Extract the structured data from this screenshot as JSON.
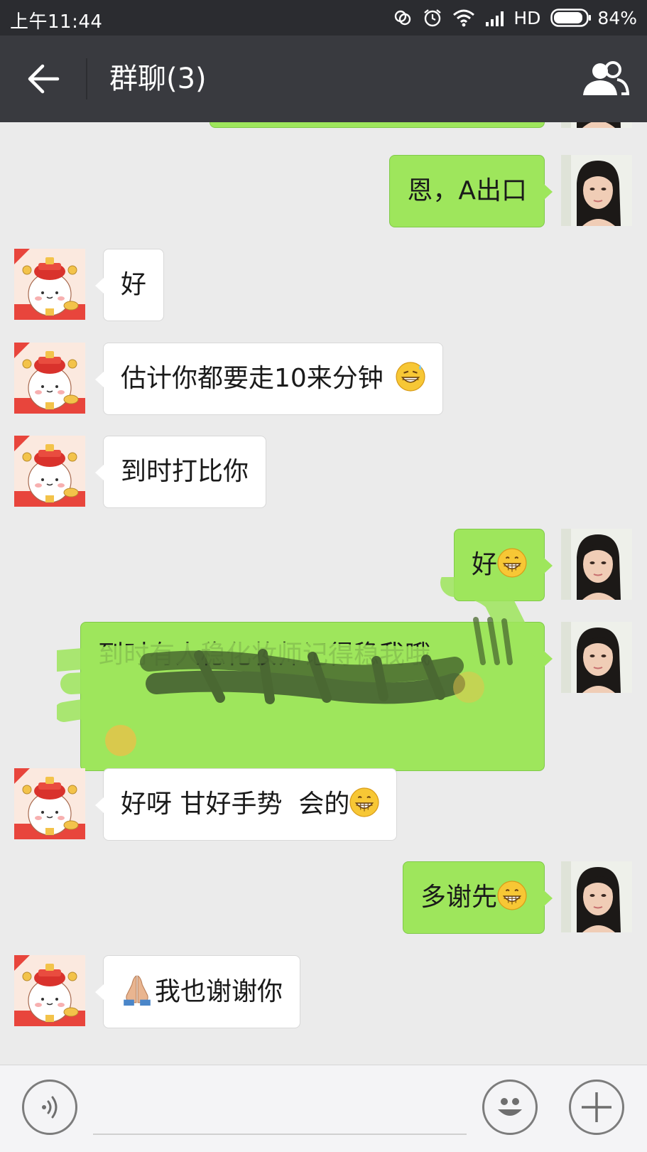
{
  "status_bar": {
    "time": "上午11:44",
    "network": "HD",
    "battery": "84%"
  },
  "header": {
    "title": "群聊(3)"
  },
  "messages": [
    {
      "id": "m1",
      "side": "out",
      "text": "恩，A出口",
      "emoji": ""
    },
    {
      "id": "m2",
      "side": "in",
      "text": "好",
      "emoji": ""
    },
    {
      "id": "m3",
      "side": "in",
      "text": "估计你都要走10来分钟",
      "emoji": "grin-sweat-emoji"
    },
    {
      "id": "m4",
      "side": "in",
      "text": "到时打比你",
      "emoji": ""
    },
    {
      "id": "m5",
      "side": "out",
      "text": "好",
      "emoji": "grin-emoji"
    },
    {
      "id": "m6",
      "side": "out",
      "text": "到时有人稳化妆师记得稳我哦",
      "emoji": "",
      "redacted": true
    },
    {
      "id": "m7",
      "side": "in",
      "text": "好呀 甘好手势  会的",
      "emoji": "grin-emoji"
    },
    {
      "id": "m8",
      "side": "out",
      "text": "多谢先",
      "emoji": "grin-emoji"
    },
    {
      "id": "m9",
      "side": "in",
      "text": "我也谢谢你",
      "emoji": "folded-hands-emoji"
    }
  ],
  "colors": {
    "header_bg": "#393a3f",
    "status_bg": "#2b2c30",
    "chat_bg": "#ebebeb",
    "out_bubble": "#9ee65c",
    "in_bubble": "#ffffff"
  },
  "icons": {
    "back": "back-arrow-icon",
    "members": "group-members-icon",
    "voice": "voice-icon",
    "emoji": "smiley-icon",
    "more": "plus-icon"
  }
}
